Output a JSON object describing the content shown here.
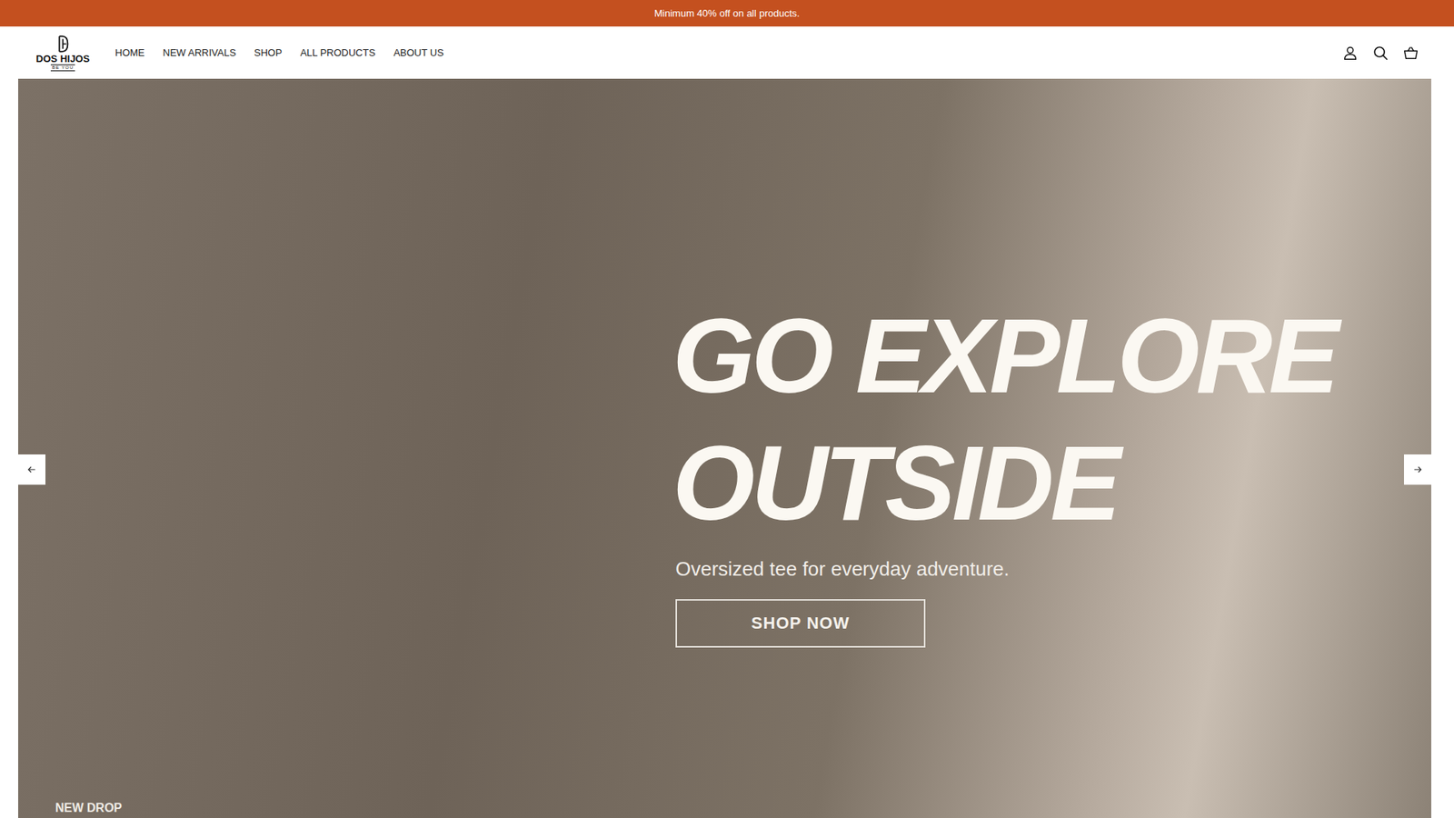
{
  "announcement": "Minimum 40% off on all products.",
  "logo": {
    "name": "DOS HIJOS",
    "tagline": "BE YOU"
  },
  "nav": [
    {
      "label": "HOME"
    },
    {
      "label": "NEW ARRIVALS"
    },
    {
      "label": "SHOP"
    },
    {
      "label": "ALL PRODUCTS"
    },
    {
      "label": "ABOUT US"
    }
  ],
  "hero": {
    "heading": [
      "GO EXPLORE",
      "OUTSIDE"
    ],
    "subtitle": "Oversized tee for everyday adventure.",
    "button": "SHOP NOW",
    "badge": "NEW DROP"
  }
}
